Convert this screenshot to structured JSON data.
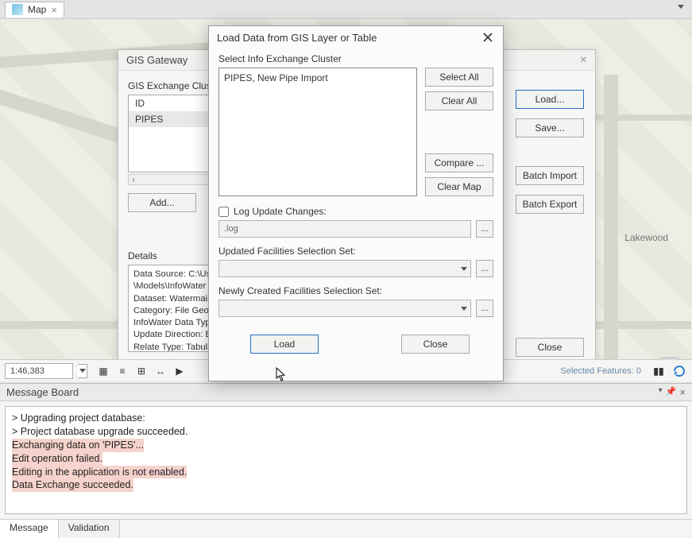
{
  "tabbar": {
    "map_label": "Map"
  },
  "map": {
    "lakewood_label": "Lakewood"
  },
  "footer": {
    "scale": "1:46,383",
    "selected_features": "Selected Features: 0"
  },
  "gateway": {
    "title": "GIS Gateway",
    "cluster_label": "GIS Exchange Cluster",
    "list": {
      "id": "ID",
      "pipes": "PIPES"
    },
    "add_btn": "Add...",
    "right": {
      "load": "Load...",
      "save": "Save...",
      "batch_import": "Batch Import",
      "batch_export": "Batch Export",
      "close": "Close"
    },
    "details": {
      "title": "Details",
      "lines": {
        "l0": "Data Source: C:\\Use",
        "l1": "\\Models\\InfoWater P",
        "l2": "Dataset: Watermains",
        "l3": "Category: File Geod",
        "l4": "InfoWater Data Type:",
        "l5": "Update Direction: Bi-",
        "l6": "Relate Type: Tabular"
      }
    }
  },
  "dialog": {
    "title": "Load Data from GIS Layer or Table",
    "select_label": "Select Info Exchange Cluster",
    "cluster_item": "PIPES, New Pipe Import",
    "btns": {
      "select_all": "Select All",
      "clear_all": "Clear All",
      "compare": "Compare ...",
      "clear_map": "Clear Map"
    },
    "log_check_label": "Log Update Changes:",
    "log_value": ".log",
    "updated_label": "Updated Facilities Selection Set:",
    "newly_label": "Newly Created Facilities Selection Set:",
    "ellipsis": "...",
    "load_btn": "Load",
    "close_btn": "Close"
  },
  "msg": {
    "title": "Message Board",
    "lines": {
      "m0": "> Upgrading project database:",
      "m1": "> Project database upgrade succeeded.",
      "m2": "Exchanging data on 'PIPES'...",
      "m3": "Edit operation failed.",
      "m4": "Editing in the application is not enabled.",
      "m5": "Data Exchange succeeded."
    },
    "tabs": {
      "message": "Message",
      "validation": "Validation"
    }
  }
}
